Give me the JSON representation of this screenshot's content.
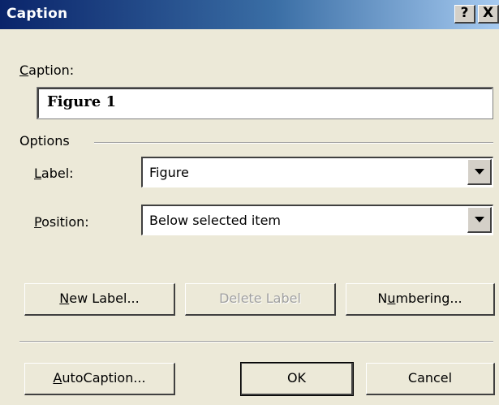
{
  "window": {
    "title": "Caption",
    "help_label": "?",
    "close_label": "X"
  },
  "caption": {
    "label_accel": "C",
    "label_rest": "aption:",
    "value": "Figure 1"
  },
  "options": {
    "group_label": "Options",
    "label": {
      "label_accel": "L",
      "label_rest": "abel:",
      "selected": "Figure"
    },
    "position": {
      "label_accel": "P",
      "label_rest": "osition:",
      "selected": "Below selected item"
    }
  },
  "buttons": {
    "new_label": {
      "accel": "N",
      "rest": "ew Label..."
    },
    "delete_label": "Delete Label",
    "numbering": {
      "pre": "N",
      "accel": "u",
      "rest": "mbering..."
    },
    "autocaption": {
      "accel": "A",
      "rest": "utoCaption..."
    },
    "ok": "OK",
    "cancel": "Cancel"
  },
  "colors": {
    "title_gradient_start": "#0a246a",
    "title_gradient_end": "#a6caf0",
    "dialog_background": "#ece9d8"
  }
}
